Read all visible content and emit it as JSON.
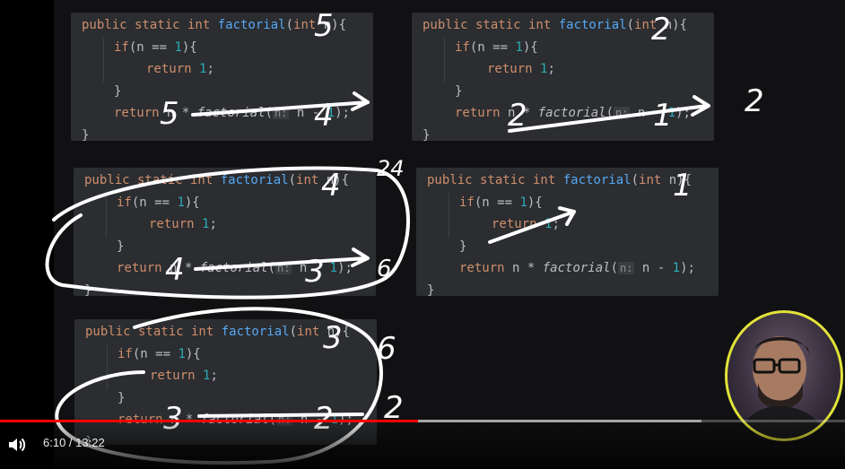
{
  "code_blocks": [
    {
      "lines": {
        "signature": {
          "kw1": "public static int ",
          "fn": "factorial",
          "open": "(",
          "param_kw": "int ",
          "param": "n",
          "close": "){"
        },
        "if_line": {
          "kw": "if",
          "rest": "(n == ",
          "num": "1",
          "tail": "){"
        },
        "return1": {
          "kw": "return ",
          "num": "1",
          "tail": ";"
        },
        "brace_close": "}",
        "return_rec": {
          "kw": "return ",
          "pre": "n * ",
          "fn": "factorial",
          "open": "(",
          "hint": "n:",
          "arg": " n - ",
          "num": "1",
          "tail": ");"
        },
        "end": "}"
      }
    }
  ],
  "annotations": {
    "block1_n": "5",
    "block1_ret_left": "5",
    "block1_ret_right": "4",
    "block2_n": "2",
    "block2_ret_left": "2",
    "block2_ret_right": "1",
    "block2_result": "2",
    "block3_n": "4",
    "block3_ret_left": "4",
    "block3_ret_right": "3",
    "block3_result_top": "24",
    "block3_result_side": "6",
    "block4_n": "1",
    "block5_n": "3",
    "block5_ret_left": "3",
    "block5_ret_right": "2",
    "block5_result_top": "6",
    "block5_result_side": "2"
  },
  "player": {
    "current_time": "6:10",
    "separator": " / ",
    "duration": "13:22",
    "played_fraction": 0.495,
    "buffered_fraction": 0.83
  },
  "colors": {
    "keyword": "#cf8e6d",
    "function": "#56a8f5",
    "number": "#2aacb8",
    "progress": "#ff0000",
    "webcam_border": "#e2e23a"
  },
  "icons": {
    "volume": "volume-icon"
  }
}
